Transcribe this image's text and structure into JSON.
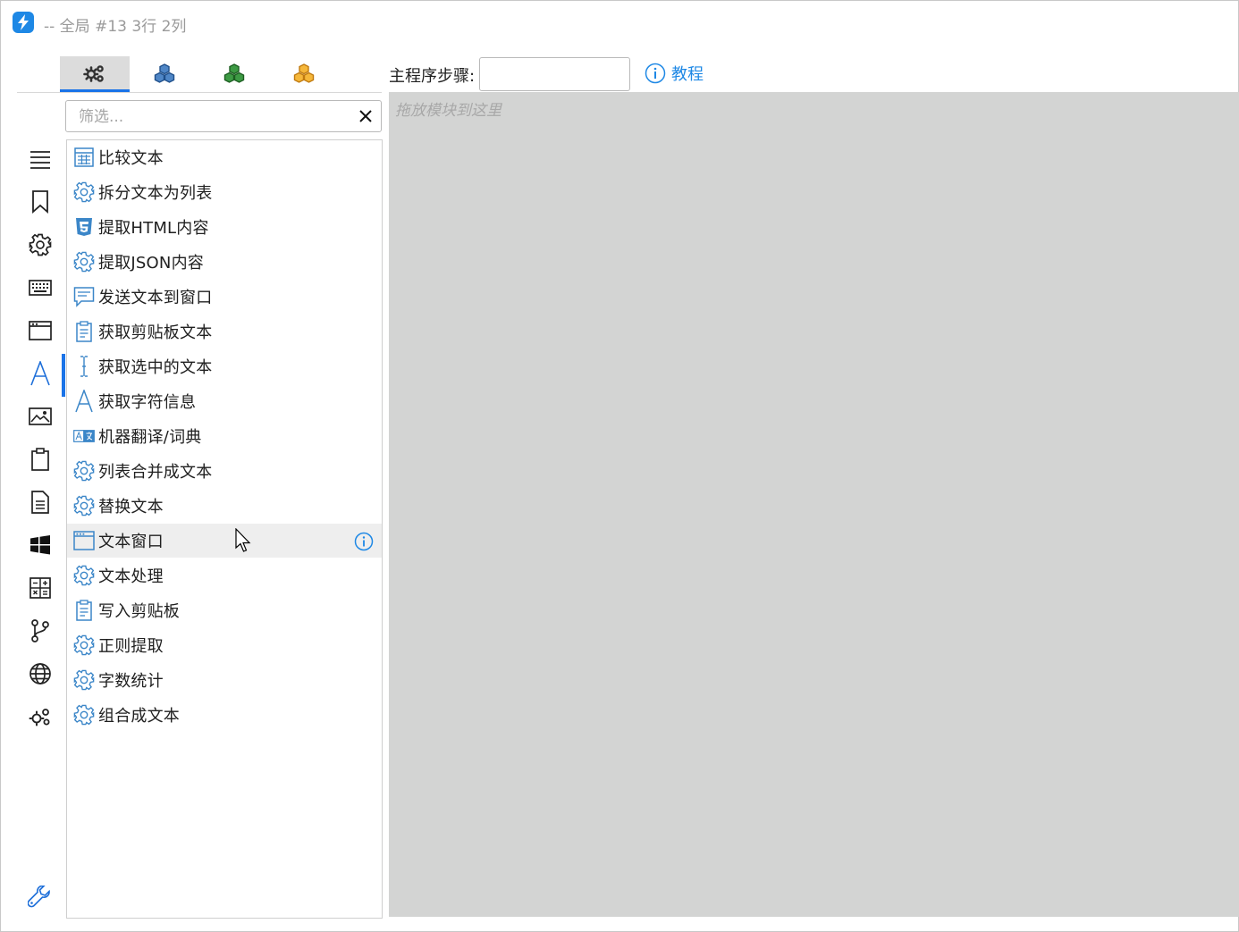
{
  "window": {
    "title": "-- 全局 #13 3行 2列",
    "accent": "#1a73e8"
  },
  "tabs": [
    {
      "name": "gears-icon",
      "color": "#333333",
      "active": true
    },
    {
      "name": "cubes-blue-icon",
      "color": "#2f6db5",
      "active": false
    },
    {
      "name": "cubes-green-icon",
      "color": "#2e7d32",
      "active": false
    },
    {
      "name": "cubes-orange-icon",
      "color": "#f0a020",
      "active": false
    }
  ],
  "filter": {
    "placeholder": "筛选..."
  },
  "sidebar": [
    {
      "name": "menu-icon"
    },
    {
      "name": "bookmark-icon"
    },
    {
      "name": "gear-icon"
    },
    {
      "name": "keyboard-icon"
    },
    {
      "name": "window-icon"
    },
    {
      "name": "text-a-icon",
      "active": true
    },
    {
      "name": "image-icon"
    },
    {
      "name": "clipboard-icon"
    },
    {
      "name": "document-icon"
    },
    {
      "name": "windows-logo-icon"
    },
    {
      "name": "calculator-icon"
    },
    {
      "name": "branch-icon"
    },
    {
      "name": "globe-icon"
    },
    {
      "name": "gears-icon"
    },
    {
      "name": "wrench-icon"
    }
  ],
  "list": {
    "items": [
      {
        "label": "比较文本",
        "icon": "table-icon"
      },
      {
        "label": "拆分文本为列表",
        "icon": "gear-icon"
      },
      {
        "label": "提取HTML内容",
        "icon": "html5-icon"
      },
      {
        "label": "提取JSON内容",
        "icon": "gear-icon"
      },
      {
        "label": "发送文本到窗口",
        "icon": "message-icon"
      },
      {
        "label": "获取剪贴板文本",
        "icon": "clipboard-icon"
      },
      {
        "label": "获取选中的文本",
        "icon": "text-cursor-icon"
      },
      {
        "label": "获取字符信息",
        "icon": "text-a-icon"
      },
      {
        "label": "机器翻译/词典",
        "icon": "translate-icon"
      },
      {
        "label": "列表合并成文本",
        "icon": "gear-icon"
      },
      {
        "label": "替换文本",
        "icon": "gear-icon"
      },
      {
        "label": "文本窗口",
        "icon": "window-icon",
        "hovered": true
      },
      {
        "label": "文本处理",
        "icon": "gear-icon"
      },
      {
        "label": "写入剪贴板",
        "icon": "clipboard-icon"
      },
      {
        "label": "正则提取",
        "icon": "gear-icon"
      },
      {
        "label": "字数统计",
        "icon": "gear-icon"
      },
      {
        "label": "组合成文本",
        "icon": "gear-icon"
      }
    ]
  },
  "main": {
    "step_label": "主程序步骤:",
    "step_value": "",
    "tutorial_label": "教程",
    "drop_hint": "拖放模块到这里"
  }
}
